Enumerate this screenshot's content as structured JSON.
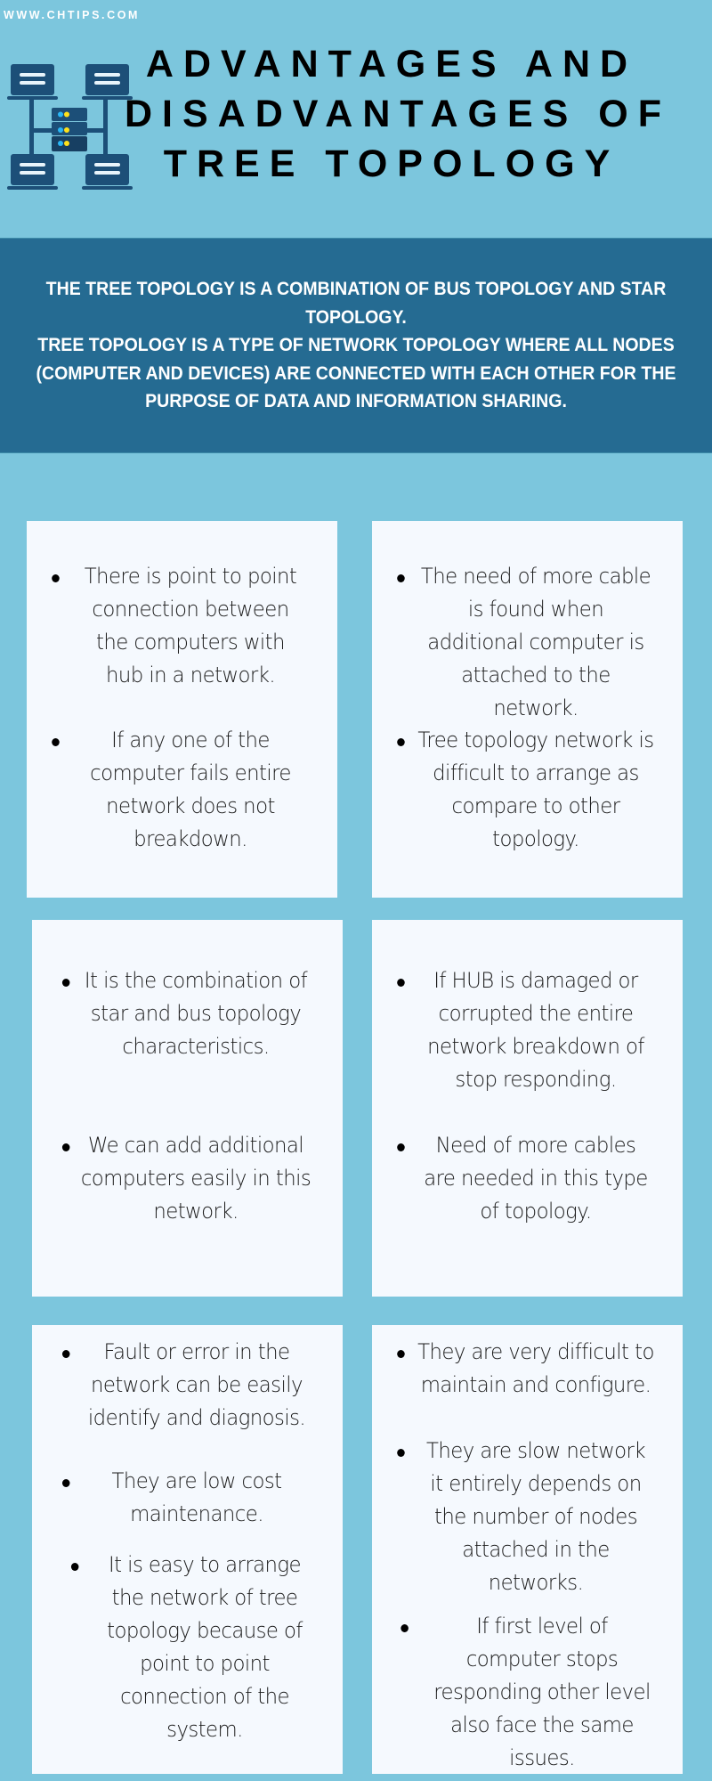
{
  "site_url": "WWW.CHTIPS.COM",
  "title_lines": [
    "ADVANTAGES AND",
    "DISADVANTAGES OF",
    "TREE TOPOLOGY"
  ],
  "logo": {
    "icon": "tree-topology-network-icon"
  },
  "banner": {
    "paragraphs": [
      "THE TREE TOPOLOGY IS A COMBINATION OF BUS TOPOLOGY AND STAR TOPOLOGY.",
      "TREE TOPOLOGY IS A TYPE OF NETWORK TOPOLOGY WHERE ALL NODES (COMPUTER AND DEVICES) ARE CONNECTED WITH EACH OTHER FOR THE PURPOSE OF DATA AND INFORMATION SHARING."
    ]
  },
  "colors": {
    "background": "#7cc6dd",
    "banner": "#256b92",
    "card": "#f5f9fe",
    "icon_dark": "#1c4f78",
    "icon_light": "#e8f4fb",
    "led_blue": "#29b6f6",
    "led_yellow": "#ffe11a"
  },
  "advantages": [
    [
      "There is point to point connection between the computers with hub in a network.",
      "If any one of the computer fails entire network does not breakdown."
    ],
    [
      "It is the combination of star and bus topology characteristics.",
      "We can add additional computers easily in this network."
    ],
    [
      "Fault or error in the network can be easily identify and diagnosis.",
      "They are low cost maintenance.",
      "It is easy to arrange the network of tree topology because of point to point connection of the system."
    ]
  ],
  "disadvantages": [
    [
      "The need of more cable is found when additional computer is attached to the network.",
      "Tree topology network is difficult to arrange as compare to other topology."
    ],
    [
      "If HUB is damaged or corrupted the entire network breakdown of stop responding.",
      "Need of more cables are needed in this type of topology."
    ],
    [
      "They are very difficult to maintain and configure.",
      "They are slow network it entirely depends on the number of nodes attached in the networks.",
      "If first level of computer stops responding other level also face the same issues."
    ]
  ]
}
